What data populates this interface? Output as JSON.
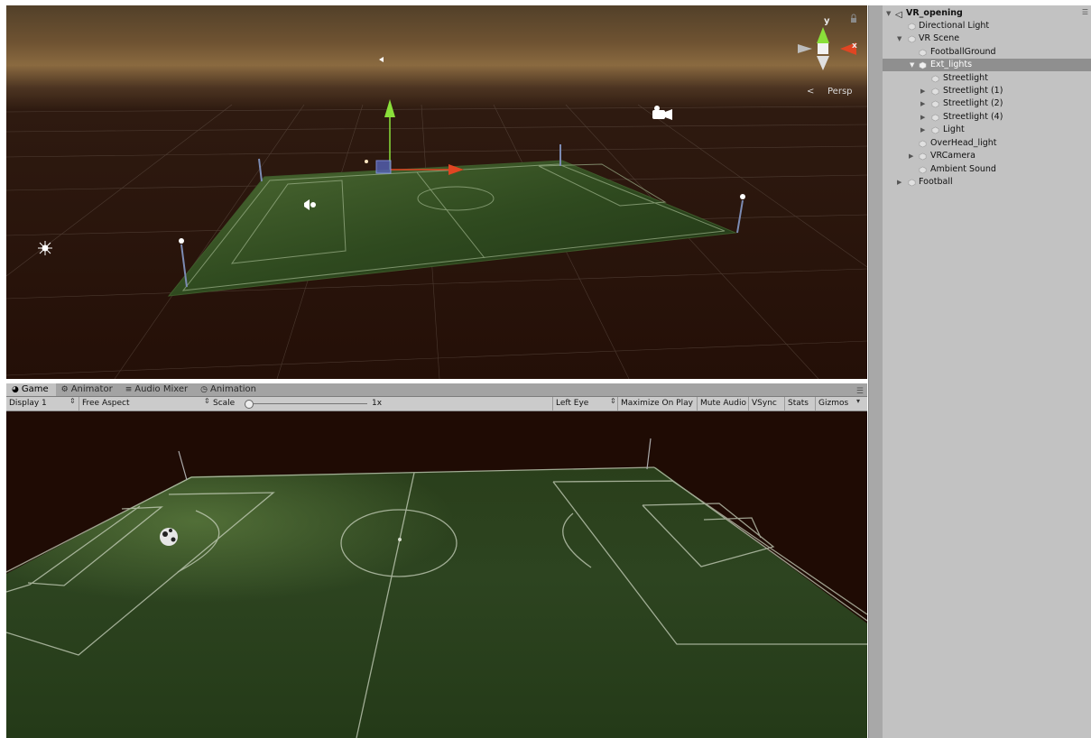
{
  "scene_view": {
    "camera_mode": "Persp",
    "gizmo_axes": {
      "y": "y",
      "x": "x"
    },
    "icons": [
      "sun-icon",
      "camera-icon",
      "audio-source-icon",
      "streetlight-gizmo-icon",
      "move-handle-icon",
      "lock-icon"
    ]
  },
  "game_view": {
    "tabs": [
      {
        "label": "Game",
        "icon": "game-icon",
        "active": true
      },
      {
        "label": "Animator",
        "icon": "animator-icon",
        "active": false
      },
      {
        "label": "Audio Mixer",
        "icon": "audio-mixer-icon",
        "active": false
      },
      {
        "label": "Animation",
        "icon": "animation-icon",
        "active": false
      }
    ],
    "toolbar": {
      "display": "Display 1",
      "aspect": "Free Aspect",
      "scale_label": "Scale",
      "scale_value": "1x",
      "eye": "Left Eye",
      "maximize_on_play": "Maximize On Play",
      "mute_audio": "Mute Audio",
      "vsync": "VSync",
      "stats": "Stats",
      "gizmos": "Gizmos"
    }
  },
  "hierarchy": {
    "items": [
      {
        "label": "VR_opening",
        "depth": 0,
        "expanded": true,
        "root": true
      },
      {
        "label": "Directional Light",
        "depth": 1
      },
      {
        "label": "VR Scene",
        "depth": 1,
        "expanded": true
      },
      {
        "label": "FootballGround",
        "depth": 2
      },
      {
        "label": "Ext_lights",
        "depth": 2,
        "expanded": true,
        "selected": true
      },
      {
        "label": "Streetlight",
        "depth": 3
      },
      {
        "label": "Streetlight (1)",
        "depth": 3,
        "expanded": false
      },
      {
        "label": "Streetlight (2)",
        "depth": 3,
        "expanded": false
      },
      {
        "label": "Streetlight (4)",
        "depth": 3,
        "expanded": false
      },
      {
        "label": "Light",
        "depth": 3,
        "expanded": false
      },
      {
        "label": "OverHead_light",
        "depth": 2
      },
      {
        "label": "VRCamera",
        "depth": 2,
        "expanded": false
      },
      {
        "label": "Ambient Sound",
        "depth": 2
      },
      {
        "label": "Football",
        "depth": 1,
        "expanded": false
      }
    ]
  },
  "colors": {
    "field_green": "#2f4a1f",
    "field_green_dark": "#1c2f13",
    "sky_glow": "#8a6a40",
    "selection": "#8f8f8f"
  }
}
